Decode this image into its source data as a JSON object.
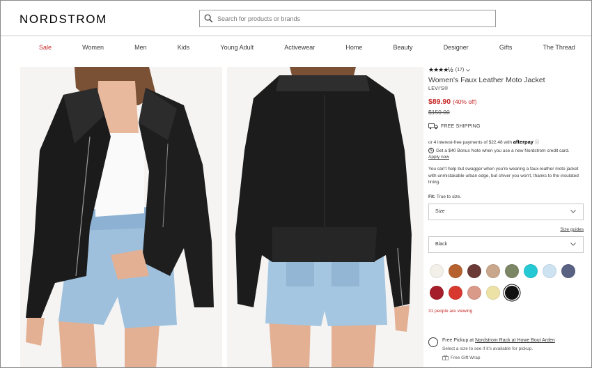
{
  "header": {
    "logo": "NORDSTROM",
    "search_placeholder": "Search for products or brands"
  },
  "nav": [
    "Sale",
    "Women",
    "Men",
    "Kids",
    "Young Adult",
    "Activewear",
    "Home",
    "Beauty",
    "Designer",
    "Gifts",
    "The Thread"
  ],
  "product": {
    "rating_stars": "★★★★½",
    "rating_value": 4.5,
    "review_count": "(17)",
    "title": "Women's Faux Leather Moto Jacket",
    "brand": "LEVI'S®",
    "price": "$89.90",
    "discount": "(40% off)",
    "original_price": "$150.00",
    "shipping": "FREE SHIPPING",
    "afterpay_text": "or 4 interest-free payments of $22.48 with",
    "afterpay_brand": "afterpay",
    "bonus_note": "Get a $40 Bonus Note when you use a new Nordstrom credit card.",
    "apply_now": "Apply now",
    "description": "You can't help but swagger when you're wearing a faux-leather moto jacket with unmistakable urban edge, but shiver you won't, thanks to the insulated lining.",
    "fit_label": "Fit:",
    "fit_value": "True to size.",
    "size_select": "Size",
    "size_guides": "Size guides",
    "color_select": "Black",
    "viewing": "31 people are viewing"
  },
  "swatches": [
    {
      "color": "#f3f0ea"
    },
    {
      "color": "#b5622f"
    },
    {
      "color": "#6b3a36"
    },
    {
      "color": "#c9a78c"
    },
    {
      "color": "#7b8664"
    },
    {
      "color": "#25c9d3"
    },
    {
      "color": "#cde3f2"
    },
    {
      "color": "#5a6284"
    },
    {
      "color": "#a51d2a"
    },
    {
      "color": "#d8392e"
    },
    {
      "color": "#d99a8a"
    },
    {
      "color": "#ede2a6"
    },
    {
      "color": "#111111",
      "selected": true
    }
  ],
  "pickup": {
    "title_prefix": "Free Pickup at",
    "store": "Nordstrom Rack at Howe Bout Arden",
    "subtitle": "Select a size to see if it's available for pickup.",
    "gift_wrap": "Free Gift Wrap"
  },
  "colors": {
    "accent_red": "#c62828",
    "text": "#393939"
  }
}
